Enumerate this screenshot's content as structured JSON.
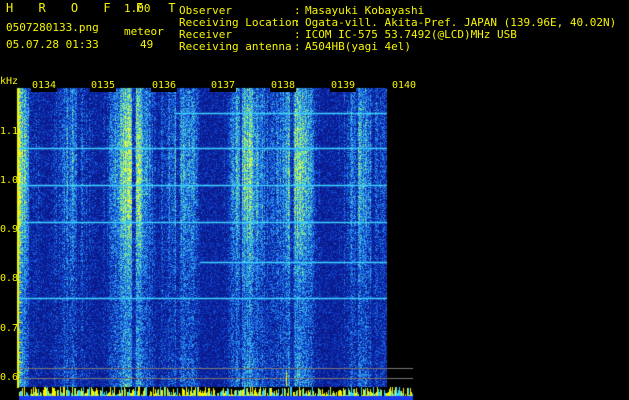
{
  "header": {
    "app_title": "H R O F F T",
    "version": "1.00",
    "filename": "0507280133.png",
    "mode_label": "meteor",
    "datetime": "05.07.28 01:33",
    "count": "49",
    "info_labels": [
      "Observer",
      "Receiving Location",
      "Receiver",
      "Receiving antenna"
    ],
    "info_colons": [
      ":",
      ":",
      ":",
      ":"
    ],
    "info_values": [
      "Masayuki Kobayashi",
      "Ogata-vill. Akita-Pref. JAPAN (139.96E, 40.02N)",
      "ICOM IC-575 53.7492(@LCD)MHz USB",
      "A504HB(yagi 4el)"
    ]
  },
  "axis": {
    "y_unit": "kHz",
    "y_ticks": [
      "1.1",
      "1.0",
      "0.9",
      "0.8",
      "0.7",
      "0.6"
    ],
    "x_ticks": [
      "0134",
      "0135",
      "0136",
      "0137",
      "0138",
      "0139",
      "0140"
    ]
  },
  "colors": {
    "text_yellow": "#f5f500",
    "text_cyan": "#38e6ff",
    "background": "#000000",
    "spectrogram_low": "#0a1a8c",
    "spectrogram_high": "#ffff00"
  }
}
